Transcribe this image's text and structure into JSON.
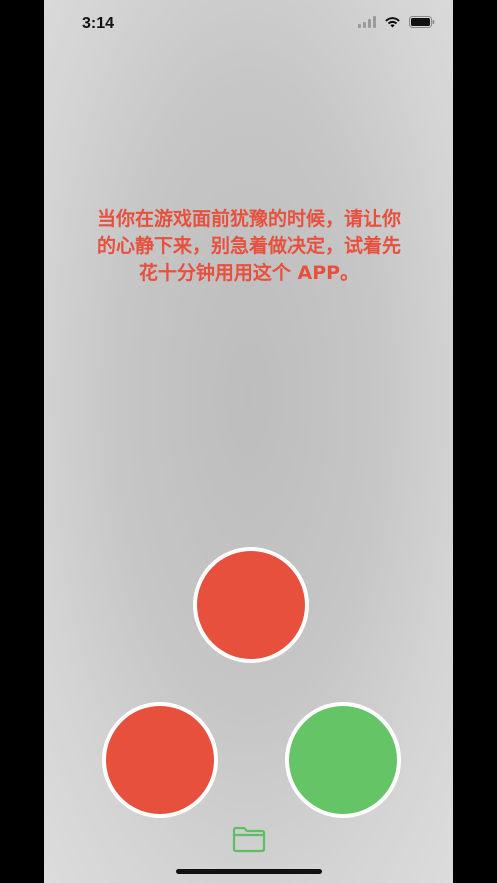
{
  "status_bar": {
    "time": "3:14"
  },
  "main": {
    "message": "当你在游戏面前犹豫的时候，请让你的心静下来，别急着做决定，试着先花十分钟用用这个 APP。"
  },
  "buttons": {
    "top": {
      "color": "#e8503e"
    },
    "left": {
      "color": "#e8503e"
    },
    "right": {
      "color": "#64c466"
    }
  },
  "toolbar": {
    "folder_icon": "folder-icon",
    "folder_color": "#5cbf62"
  },
  "icons": [
    "signal-icon",
    "wifi-icon",
    "battery-icon",
    "folder-icon"
  ]
}
